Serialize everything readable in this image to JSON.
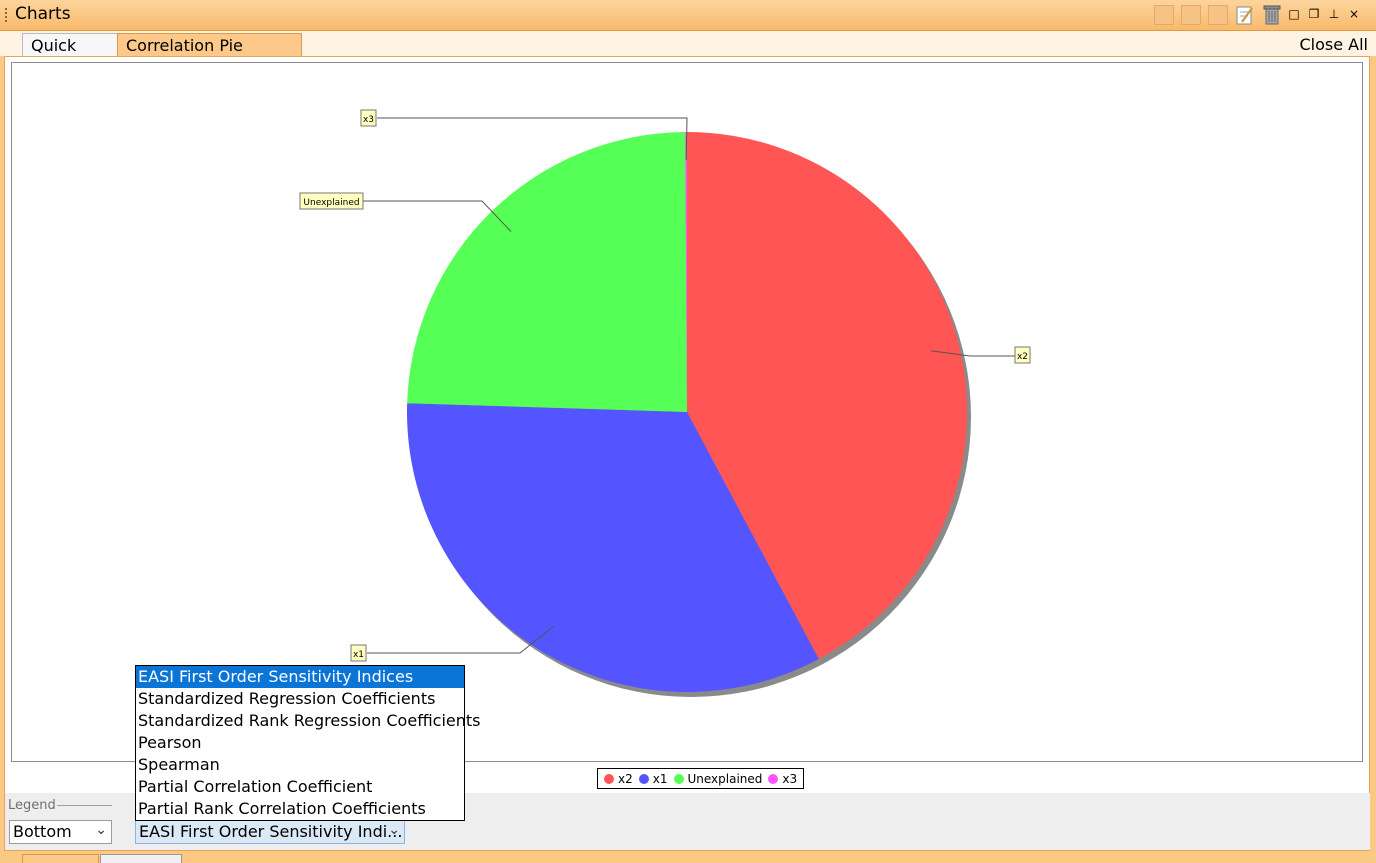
{
  "window": {
    "title": "Charts"
  },
  "tabs": [
    {
      "label": "Quick View",
      "active": false
    },
    {
      "label": "Correlation Pie Chart",
      "active": true,
      "close": "×"
    }
  ],
  "close_all_label": "Close All",
  "chart_data": {
    "type": "pie",
    "slices": [
      {
        "label": "x2",
        "value": 42.2,
        "color": "#ff5555"
      },
      {
        "label": "x1",
        "value": 33.3,
        "color": "#5555ff"
      },
      {
        "label": "Unexplained",
        "value": 24.4,
        "color": "#55ff55"
      },
      {
        "label": "x3",
        "value": 0.1,
        "color": "#ff55ff"
      }
    ],
    "legend": [
      "x2",
      "x1",
      "Unexplained",
      "x3"
    ],
    "legend_position": "bottom"
  },
  "controls": {
    "legend_caption": "Legend",
    "legend_select_value": "Bottom",
    "method_select_value": "EASI First Order Sensitivity Indi...",
    "method_options": [
      "EASI First Order Sensitivity Indices",
      "Standardized Regression Coefficients",
      "Standardized Rank Regression Coefficients",
      "Pearson",
      "Spearman",
      "Partial Correlation Coefficient",
      "Partial Rank Correlation Coefficients"
    ],
    "selected_option_index": 0
  },
  "icons": {
    "dropdown": "▼",
    "close": "×"
  }
}
